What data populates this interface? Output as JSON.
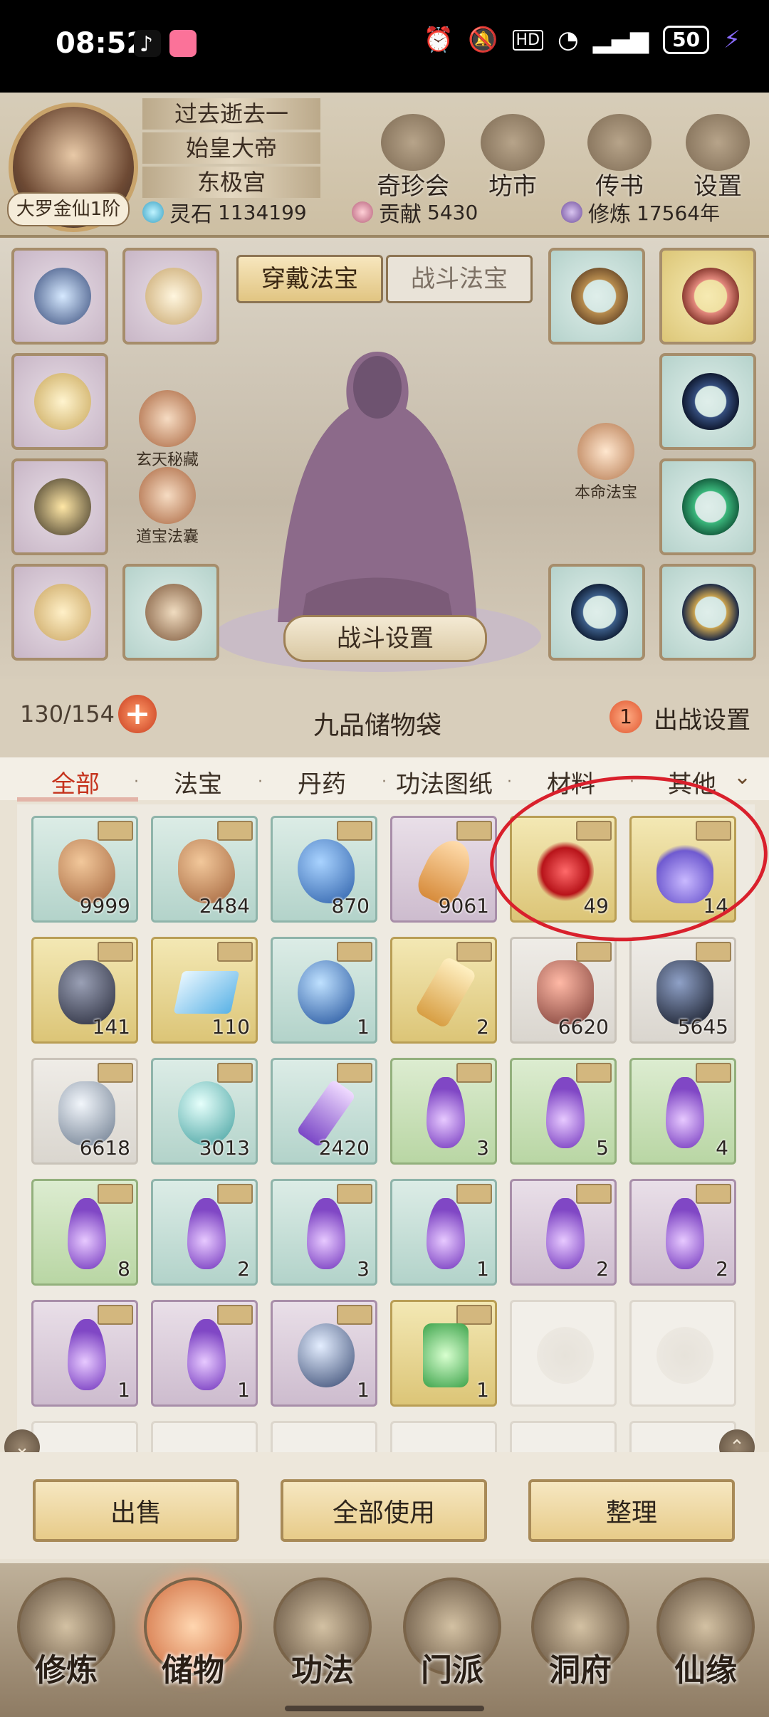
{
  "status_bar": {
    "time": "08:52",
    "apps": [
      "tiktok-icon",
      "bilibili-icon"
    ],
    "icons": [
      "alarm-icon",
      "mute-icon",
      "hd-icon",
      "wifi-icon",
      "5g-icon",
      "signal-icon"
    ],
    "battery": "50"
  },
  "player": {
    "rank": "大罗金仙1阶",
    "titles": [
      "过去逝去一",
      "始皇大帝",
      "东极宫"
    ],
    "stats": {
      "spirit_stone_label": "灵石",
      "spirit_stone_value": "1134199",
      "contribution_label": "贡献",
      "contribution_value": "5430",
      "cultivation_label": "修炼",
      "cultivation_value": "17564年"
    }
  },
  "header_buttons": [
    "奇珍会",
    "坊市",
    "传书",
    "设置"
  ],
  "equip": {
    "tabs": [
      "穿戴法宝",
      "战斗法宝"
    ],
    "left_badges": [
      "玄天秘藏",
      "道宝法囊"
    ],
    "right_badge": "本命法宝",
    "battle_settings": "战斗设置"
  },
  "bag": {
    "count": "130/154",
    "plus": "+",
    "title": "九品储物袋",
    "deploy_count": "1",
    "deploy_label": "出战设置"
  },
  "filters": [
    "全部",
    "法宝",
    "丹药",
    "功法图纸",
    "材料",
    "其他"
  ],
  "grid": {
    "rows": [
      [
        {
          "bg": "teal",
          "icon": "ore",
          "qty": "9999"
        },
        {
          "bg": "teal",
          "icon": "ore",
          "qty": "2484"
        },
        {
          "bg": "teal",
          "icon": "blue",
          "qty": "870"
        },
        {
          "bg": "purple",
          "icon": "amber",
          "qty": "9061"
        },
        {
          "bg": "gold",
          "icon": "flower",
          "qty": "49"
        },
        {
          "bg": "gold",
          "icon": "vial",
          "qty": "14"
        }
      ],
      [
        {
          "bg": "gold",
          "icon": "dark",
          "qty": "141"
        },
        {
          "bg": "gold",
          "icon": "map",
          "qty": "110"
        },
        {
          "bg": "teal",
          "icon": "orb",
          "qty": "1"
        },
        {
          "bg": "gold",
          "icon": "crystal",
          "qty": "2"
        },
        {
          "bg": "grey",
          "icon": "redstone",
          "qty": "6620"
        },
        {
          "bg": "grey",
          "icon": "obsidian",
          "qty": "5645"
        }
      ],
      [
        {
          "bg": "grey",
          "icon": "silver",
          "qty": "6618"
        },
        {
          "bg": "teal",
          "icon": "cyan",
          "qty": "3013"
        },
        {
          "bg": "teal",
          "icon": "violetcry",
          "qty": "2420"
        },
        {
          "bg": "green",
          "icon": "drop",
          "qty": "3"
        },
        {
          "bg": "green",
          "icon": "drop",
          "qty": "5"
        },
        {
          "bg": "green",
          "icon": "drop",
          "qty": "4"
        }
      ],
      [
        {
          "bg": "green",
          "icon": "drop",
          "qty": "8"
        },
        {
          "bg": "teal",
          "icon": "drop",
          "qty": "2"
        },
        {
          "bg": "teal",
          "icon": "drop",
          "qty": "3"
        },
        {
          "bg": "teal",
          "icon": "drop",
          "qty": "1"
        },
        {
          "bg": "purple",
          "icon": "drop",
          "qty": "2"
        },
        {
          "bg": "purple",
          "icon": "drop",
          "qty": "2"
        }
      ],
      [
        {
          "bg": "purple",
          "icon": "drop",
          "qty": "1"
        },
        {
          "bg": "purple",
          "icon": "drop",
          "qty": "1"
        },
        {
          "bg": "purple",
          "icon": "taiji",
          "qty": "1"
        },
        {
          "bg": "gold",
          "icon": "jade",
          "qty": "1"
        },
        {
          "bg": "empty",
          "icon": "",
          "qty": ""
        },
        {
          "bg": "empty",
          "icon": "",
          "qty": ""
        }
      ]
    ]
  },
  "actions": [
    "出售",
    "全部使用",
    "整理"
  ],
  "nav": [
    "修炼",
    "储物",
    "功法",
    "门派",
    "洞府",
    "仙缘"
  ],
  "nav_active": "储物",
  "colors": {
    "accent_red": "#c5331d",
    "annotation": "#d9202c",
    "frame": "#a68d6b"
  }
}
